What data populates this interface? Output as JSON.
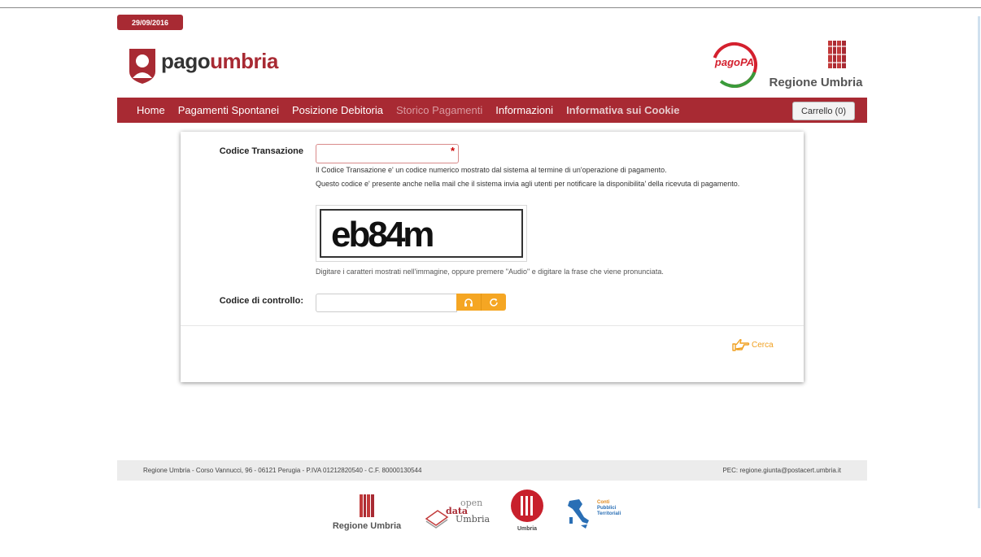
{
  "header": {
    "date": "29/09/2016",
    "logo_part1": "pago",
    "logo_part2": "umbria",
    "pagopa_text": "pagoPA",
    "region_logo_text": "Regione Umbria"
  },
  "nav": {
    "items": [
      "Home",
      "Pagamenti Spontanei",
      "Posizione Debitoria",
      "Storico Pagamenti",
      "Informazioni",
      "Informativa sui Cookie"
    ],
    "cart_label": "Carrello (0)"
  },
  "form": {
    "tx_label": "Codice Transazione",
    "tx_value": "",
    "tx_help1": "Il Codice Transazione e' un codice numerico mostrato dal sistema al termine di un'operazione di pagamento.",
    "tx_help2": "Questo codice e' presente anche nella mail che il sistema invia agli utenti per notificare la disponibilita' della ricevuta di pagamento.",
    "captcha_text": "eb84m",
    "captcha_help": "Digitare i caratteri mostrati nell'immagine, oppure premere \"Audio\" e digitare la frase che viene pronunciata.",
    "ctrl_label": "Codice di controllo:",
    "ctrl_value": "",
    "search_label": "Cerca"
  },
  "footer": {
    "address": "Regione Umbria - Corso Vannucci, 96 - 06121 Perugia - P.IVA 01212820540 - C.F. 80000130544",
    "pec": "PEC: regione.giunta@postacert.umbria.it",
    "logo_regione": "Regione Umbria",
    "opendata_top": "open",
    "opendata_mid": "data",
    "opendata_bottom": "Umbria",
    "umbria_caption": "Umbria",
    "conti_line1": "Conti",
    "conti_line2": "Pubblici",
    "conti_line3": "Territoriali"
  },
  "colors": {
    "brand": "#a82a33",
    "accent": "#f5a623"
  },
  "icons": {
    "audio": "headphones-icon",
    "refresh": "refresh-icon",
    "search": "pointing-hand-icon"
  }
}
